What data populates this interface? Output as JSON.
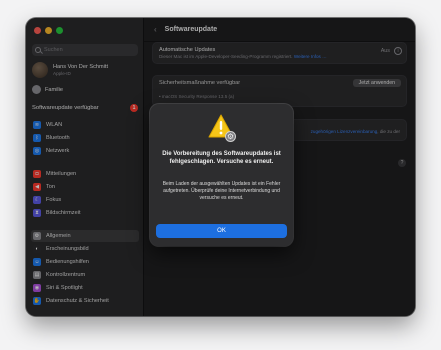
{
  "window": {
    "title": "Softwareupdate"
  },
  "search": {
    "placeholder": "Suchen"
  },
  "account": {
    "name": "Hans Von Der Schmitt",
    "subtitle": "Apple-ID"
  },
  "family": {
    "label": "Familie"
  },
  "update_row": {
    "label": "Softwareupdate verfügbar",
    "badge": "1"
  },
  "sidebar": {
    "group1": [
      {
        "label": "WLAN",
        "icon": "wifi-icon",
        "color": "#1e7cf2",
        "glyph": "≋"
      },
      {
        "label": "Bluetooth",
        "icon": "bluetooth-icon",
        "color": "#1e7cf2",
        "glyph": "ᛒ"
      },
      {
        "label": "Netzwerk",
        "icon": "globe-icon",
        "color": "#1e7cf2",
        "glyph": "◎"
      }
    ],
    "group2": [
      {
        "label": "Mitteilungen",
        "icon": "bell-icon",
        "color": "#ff3b30",
        "glyph": "◘"
      },
      {
        "label": "Ton",
        "icon": "speaker-icon",
        "color": "#ff3b30",
        "glyph": "◀"
      },
      {
        "label": "Fokus",
        "icon": "moon-icon",
        "color": "#5e5ce6",
        "glyph": "☾"
      },
      {
        "label": "Bildschirmzeit",
        "icon": "hourglass-icon",
        "color": "#5e5ce6",
        "glyph": "⧗"
      }
    ],
    "group3": [
      {
        "label": "Allgemein",
        "icon": "gear-icon",
        "color": "#8e8e93",
        "glyph": "⚙",
        "selected": true
      },
      {
        "label": "Erscheinungsbild",
        "icon": "appearance-icon",
        "color": "#2c2c2e",
        "glyph": "◐"
      },
      {
        "label": "Bedienungshilfen",
        "icon": "accessibility-icon",
        "color": "#1e7cf2",
        "glyph": "☺"
      },
      {
        "label": "Kontrollzentrum",
        "icon": "control-center-icon",
        "color": "#8e8e93",
        "glyph": "▤"
      },
      {
        "label": "Siri & Spotlight",
        "icon": "siri-icon",
        "color": "#af52de",
        "glyph": "◉"
      },
      {
        "label": "Datenschutz & Sicherheit",
        "icon": "hand-icon",
        "color": "#1e7cf2",
        "glyph": "✋"
      }
    ]
  },
  "main": {
    "auto_updates": {
      "title": "Automatische Updates",
      "value": "Aus",
      "subtitle": "Dieser Mac ist im Apple-Developer-Seeding-Programm registriert.",
      "link": "Weitere Infos …"
    },
    "security": {
      "title": "Sicherheitsmaßnahme verfügbar",
      "button": "Jetzt anwenden",
      "item": "• macOS Security Response 13.5 (a)"
    },
    "license": {
      "link": "zugehörigen Lizenzvereinbarung",
      "suffix": ", die zu der"
    }
  },
  "dialog": {
    "title": "Die Vorbereitung des Softwareupdates ist fehlgeschlagen. Versuche es erneut.",
    "message": "Beim Laden der ausgewählten Updates ist ein Fehler aufgetreten. Überprüfe deine Internetverbindung und versuche es erneut.",
    "ok_label": "OK"
  }
}
